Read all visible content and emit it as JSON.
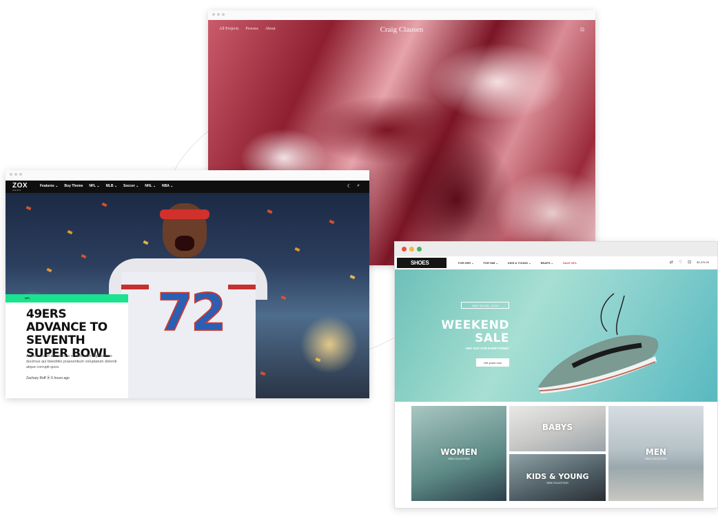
{
  "craig": {
    "nav": [
      "All Projects",
      "Process",
      "About"
    ],
    "brand": "Craig Clausen",
    "cart_icon": "bag-icon"
  },
  "zox": {
    "logo": "ZOX",
    "logo_sub": "NEWS",
    "menu": [
      "Features ⌄",
      "Buy Theme",
      "NFL ⌄",
      "MLB ⌄",
      "Soccer ⌄",
      "NHL ⌄",
      "NBA ⌄"
    ],
    "headline": "49ERS ADVANCE TO SEVENTH SUPER BOWL",
    "tag": "NFL",
    "excerpt": "At vero eos et accusamus et iusto odio dignissimos ducimus qui blanditiis praesentium voluptatum deleniti atque corrupti quos.",
    "byline": "Zachary Roff ⦿ 6 hours ago",
    "jersey_number": "72",
    "accent": "#1be28e"
  },
  "shoes": {
    "logo": "SHOES",
    "menu": [
      "FOR HER ⌄",
      "FOR HIM ⌄",
      "KIDS & YOUNG ⌄",
      "BRAPS ⌄",
      "SALE 20%"
    ],
    "price": "$2,376.99",
    "badge": "ONLY IN 4.04 - 10.04",
    "headline_1": "WEEKEND",
    "headline_2": "SALE",
    "subhead": "-25% OUT FOR EVERYTHING*",
    "button": "Get yours now",
    "tiles": [
      {
        "label": "WOMEN",
        "sub": "NEW COLLECTION"
      },
      {
        "label": "BABYS",
        "sub": ""
      },
      {
        "label": "KIDS & YOUNG",
        "sub": "NEW COLLECTION"
      },
      {
        "label": "MEN",
        "sub": "NEW COLLECTION"
      }
    ],
    "sale_color": "#e0352b"
  }
}
